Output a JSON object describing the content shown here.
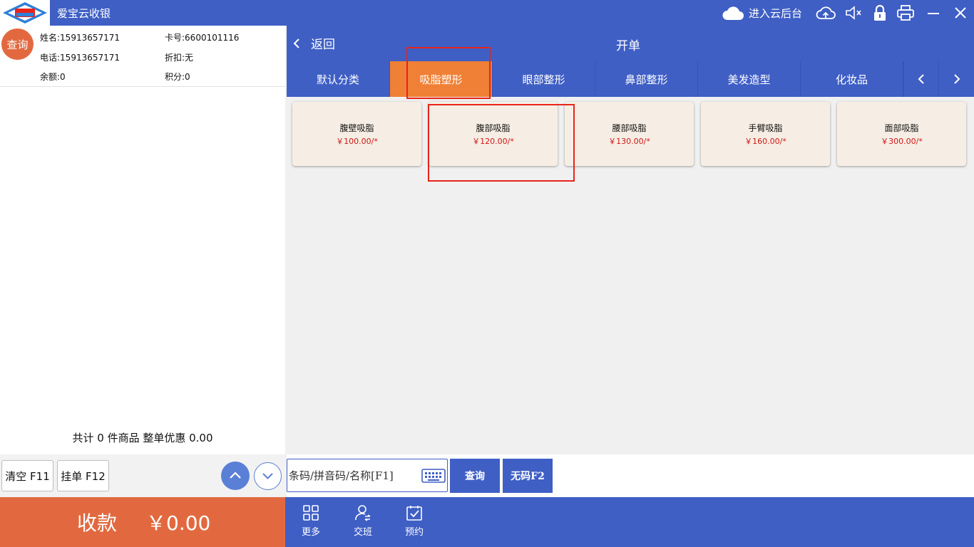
{
  "app": {
    "title": "爱宝云收银",
    "cloud_label": "进入云后台"
  },
  "member": {
    "query_label": "查询",
    "name": "姓名:15913657171",
    "card": "卡号:6600101116",
    "phone": "电话:15913657171",
    "discount": "折扣:无",
    "balance": "余额:0",
    "points": "积分:0"
  },
  "cart": {
    "summary": "共计 0 件商品 整单优惠 0.00",
    "clear_label": "清空 F11",
    "hold_label": "挂单 F12",
    "pay_label": "收款",
    "pay_amount": "￥0.00"
  },
  "header": {
    "back_label": "返回",
    "title": "开单"
  },
  "tabs": [
    {
      "label": "默认分类"
    },
    {
      "label": "吸脂塑形"
    },
    {
      "label": "眼部整形"
    },
    {
      "label": "鼻部整形"
    },
    {
      "label": "美发造型"
    },
    {
      "label": "化妆品"
    }
  ],
  "active_tab": "吸脂塑形",
  "products": [
    {
      "name": "腹壁吸脂",
      "price": "￥100.00/*"
    },
    {
      "name": "腹部吸脂",
      "price": "￥120.00/*"
    },
    {
      "name": "腰部吸脂",
      "price": "￥130.00/*"
    },
    {
      "name": "手臂吸脂",
      "price": "￥160.00/*"
    },
    {
      "name": "面部吸脂",
      "price": "￥300.00/*"
    }
  ],
  "search": {
    "placeholder": "条码/拼音码/名称[F1]",
    "query_button": "查询",
    "nocode_button": "无码F2"
  },
  "bottom_nav": [
    {
      "label": "更多"
    },
    {
      "label": "交班"
    },
    {
      "label": "预约"
    }
  ],
  "colors": {
    "brand_blue": "#3f5fc5",
    "accent_orange": "#e2693f",
    "active_tab": "#ef8035",
    "price_red": "#d01616",
    "highlight_red": "#e8241a"
  }
}
